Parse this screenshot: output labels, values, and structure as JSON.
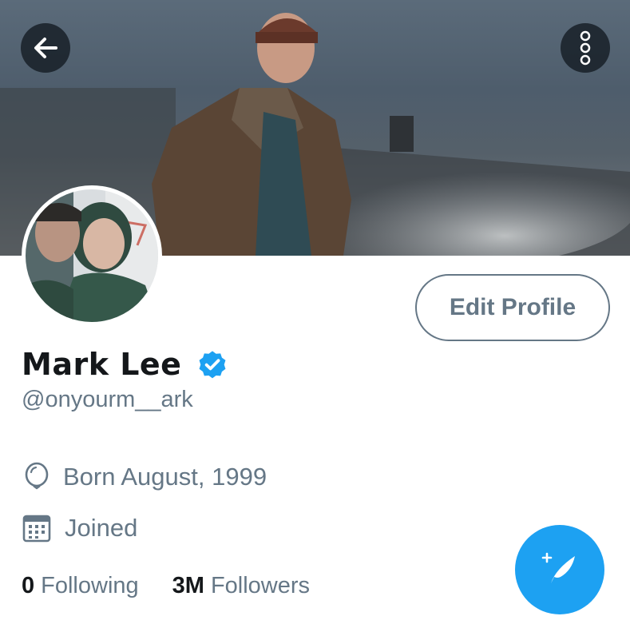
{
  "header": {
    "back_icon": "arrow-left-icon",
    "more_icon": "more-vertical-icon",
    "banner_description_icon": "photo"
  },
  "profile": {
    "name": "Mark Lee",
    "verified_icon": "verified-badge-icon",
    "handle": "@onyourm__ark",
    "edit_label": "Edit Profile",
    "birthday_icon": "balloon-icon",
    "birthday": "Born August, 1999",
    "joined_icon": "calendar-icon",
    "joined": "Joined",
    "following_count": "0",
    "following_label": "Following",
    "followers_count": "3M",
    "followers_label": "Followers"
  },
  "compose": {
    "icon": "compose-tweet-icon"
  },
  "colors": {
    "accent": "#1da1f2",
    "secondary_text": "#657786",
    "primary_text": "#14171a"
  }
}
